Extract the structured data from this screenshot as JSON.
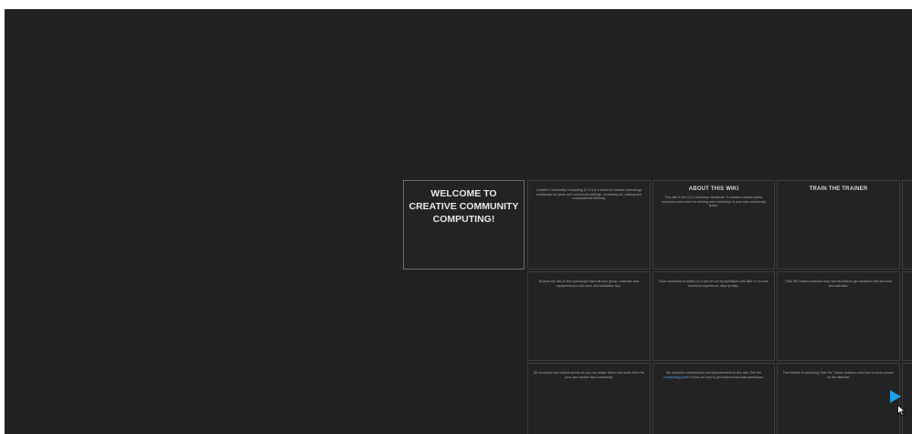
{
  "cards": {
    "welcome": {
      "title": "WELCOME TO CREATIVE COMMUNITY COMPUTING!"
    },
    "intro": {
      "body": "Creative Community Computing (CCC) is a series of creative technology workshops for youth and community settings, combining art, making and computational thinking."
    },
    "about": {
      "heading": "ABOUT THIS WIKI",
      "body": "This wiki is the CCC workshop handbook. It contains session plans, resources and notes for running each workshop in your own community space."
    },
    "trainer": {
      "heading": "TRAIN THE TRAINER"
    },
    "row2_a": {
      "body": "Browse the wiki to find workshops that suit your group, materials and equipment you will need, and facilitation tips."
    },
    "row2_b": {
      "body": "Each workshop is written so it can be run by facilitators with little or no prior technical experience, step by step."
    },
    "row2_c": {
      "body": "Train the Trainer sessions help new facilitators get confident with the tools and activities."
    },
    "row3_a": {
      "body": "All resources are shared openly so you can adapt, remix and reuse them for your own context and community."
    },
    "row3_b": {
      "body_before": "We welcome contributions and improvements to this wiki. See the",
      "link": "contributing guide",
      "body_after": "to find out how to get involved and add workshops."
    },
    "row3_c": {
      "body": "Find details of upcoming Train the Trainer sessions and how to book a place on the calendar."
    }
  },
  "icons": {
    "next": "play-arrow-icon",
    "cursor": "mouse-pointer-icon"
  },
  "colors": {
    "background": "#222222",
    "accent": "#1ea0ea",
    "link": "#5fa0d8"
  }
}
